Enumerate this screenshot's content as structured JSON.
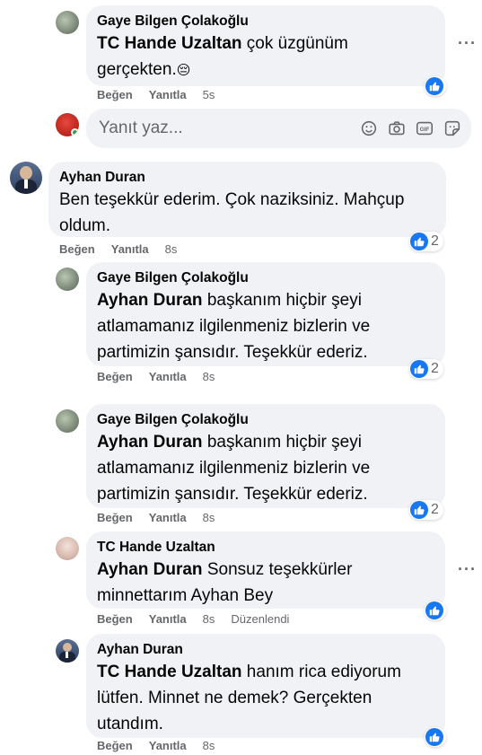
{
  "actions": {
    "like": "Beğen",
    "reply": "Yanıtla"
  },
  "reply_composer": {
    "placeholder": "Yanıt yaz..."
  },
  "comments": [
    {
      "author": "Gaye Bilgen Çolakoğlu",
      "mention": "TC Hande Uzaltan",
      "text_line1": " çok üzgünüm",
      "text_line2": "gerçekten.",
      "emoji": "😔",
      "time": "5s",
      "reaction_count": ""
    },
    {
      "author": "Ayhan Duran",
      "text_line1": "Ben teşekkür ederim. Çok naziksiniz. Mahçup",
      "text_line2": "oldum.",
      "time": "8s",
      "reaction_count": "2"
    },
    {
      "author": "Gaye Bilgen Çolakoğlu",
      "mention": "Ayhan Duran",
      "text_line1": " başkanım hiçbir şeyi",
      "text_line2": "atlamamanız ilgilenmeniz bizlerin ve",
      "text_line3": "partimizin şansıdır. Teşekkür ederiz.",
      "time": "8s",
      "reaction_count": "2"
    },
    {
      "author": "Gaye Bilgen Çolakoğlu",
      "mention": "Ayhan Duran",
      "text_line1": " başkanım hiçbir şeyi",
      "text_line2": "atlamamanız ilgilenmeniz bizlerin ve",
      "text_line3": "partimizin şansıdır. Teşekkür ederiz.",
      "time": "8s",
      "reaction_count": "2"
    },
    {
      "author": "TC Hande Uzaltan",
      "mention": "Ayhan Duran",
      "text_line1": " Sonsuz teşekkürler",
      "text_line2": "minnettarım Ayhan Bey",
      "time": "8s",
      "edited": "Düzenlendi",
      "reaction_count": ""
    },
    {
      "author": "Ayhan Duran",
      "mention": "TC Hande Uzaltan",
      "text_line1": " hanım rica ediyorum",
      "text_line2": "lütfen. Minnet ne demek? Gerçekten",
      "text_line3": "utandım.",
      "time": "8s",
      "reaction_count": ""
    }
  ],
  "colors": {
    "like_blue": "#1877f2",
    "bubble_bg": "#f0f2f5",
    "meta_gray": "#65676b"
  },
  "icons": [
    "like-icon",
    "more-icon",
    "emoji-icon",
    "camera-icon",
    "gif-icon",
    "sticker-icon"
  ]
}
